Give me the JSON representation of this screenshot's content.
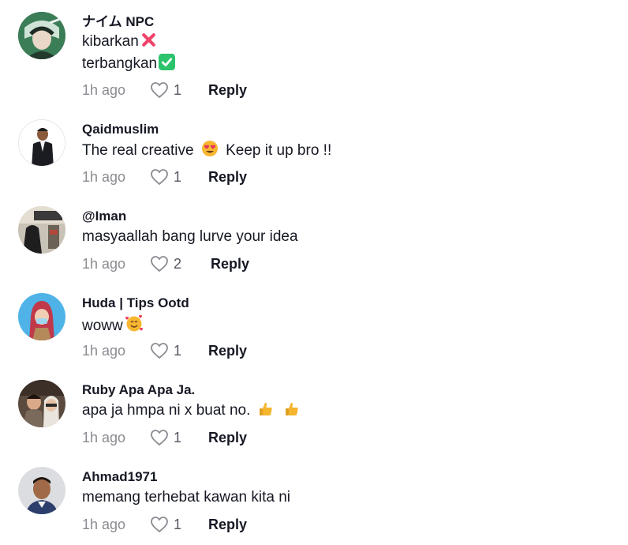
{
  "comments": [
    {
      "username": "ナイム NPC",
      "lines": [
        "kibarkan",
        "terbangkan"
      ],
      "emojis": [
        "cross-mark-emoji",
        "check-mark-emoji"
      ],
      "time": "1h ago",
      "likes": "1",
      "reply_label": "Reply"
    },
    {
      "username": "Qaidmuslim",
      "lines": [
        "The real creative",
        "Keep it up bro !!"
      ],
      "emojis": [
        "heart-eyes-emoji"
      ],
      "time": "1h ago",
      "likes": "1",
      "reply_label": "Reply"
    },
    {
      "username": "@Iman",
      "lines": [
        "masyaallah bang lurve your idea"
      ],
      "time": "1h ago",
      "likes": "2",
      "reply_label": "Reply"
    },
    {
      "username": "Huda | Tips Ootd",
      "lines": [
        "woww"
      ],
      "emojis": [
        "smiling-face-with-hearts-emoji"
      ],
      "time": "1h ago",
      "likes": "1",
      "reply_label": "Reply"
    },
    {
      "username": "Ruby Apa Apa Ja.",
      "lines": [
        "apa ja hmpa ni x buat no."
      ],
      "emojis": [
        "thumbs-up-emoji",
        "thumbs-up-emoji"
      ],
      "time": "1h ago",
      "likes": "1",
      "reply_label": "Reply"
    },
    {
      "username": "Ahmad1971",
      "lines": [
        "memang terhebat kawan kita ni"
      ],
      "time": "1h ago",
      "likes": "1",
      "reply_label": "Reply"
    }
  ],
  "colors": {
    "text": "#161823",
    "muted": "#8a8b91",
    "cross": "#f0426b",
    "check": "#2bc36b"
  }
}
